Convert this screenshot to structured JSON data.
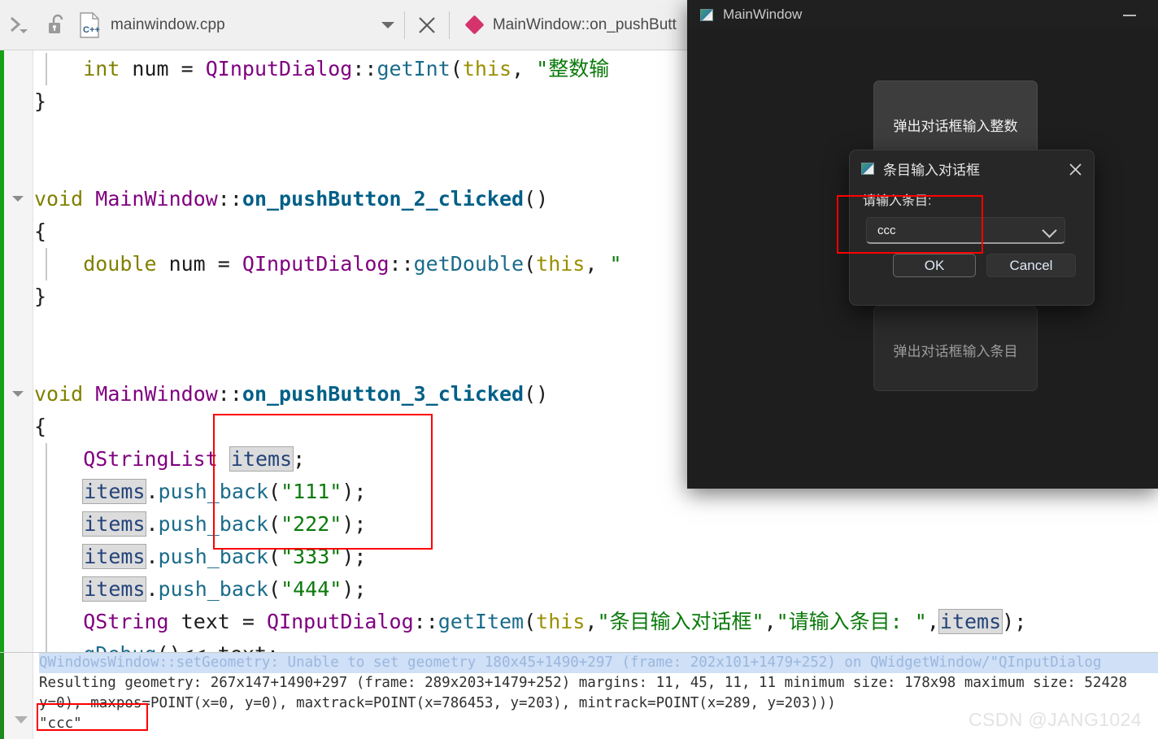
{
  "toolbar": {
    "chevron_icon": "double-chevron-icon",
    "lock_icon": "unlock-icon",
    "file_icon": "cpp-file-icon",
    "file_name": "mainwindow.cpp",
    "dropdown_icon": "chevron-down-icon",
    "close_icon": "close-icon",
    "symbol_icon": "diamond-icon",
    "symbol_name": "MainWindow::on_pushButt"
  },
  "editor": {
    "lines": [
      {
        "indent_guide": true,
        "segments": [
          {
            "cls": "t-kw",
            "text": "    int"
          },
          {
            "cls": "t-plain",
            "text": " "
          },
          {
            "cls": "t-var",
            "text": "num"
          },
          {
            "cls": "t-plain",
            "text": " = "
          },
          {
            "cls": "t-type",
            "text": "QInputDialog"
          },
          {
            "cls": "t-plain",
            "text": "::"
          },
          {
            "cls": "t-mem",
            "text": "getInt"
          },
          {
            "cls": "t-plain",
            "text": "("
          },
          {
            "cls": "t-this",
            "text": "this"
          },
          {
            "cls": "t-plain",
            "text": ", "
          },
          {
            "cls": "t-str",
            "text": "\"整数输"
          }
        ]
      },
      {
        "segments": [
          {
            "cls": "t-plain",
            "text": "}"
          }
        ]
      },
      {
        "segments": []
      },
      {
        "segments": []
      },
      {
        "fold": true,
        "segments": [
          {
            "cls": "t-kw",
            "text": "void"
          },
          {
            "cls": "t-plain",
            "text": " "
          },
          {
            "cls": "t-type",
            "text": "MainWindow"
          },
          {
            "cls": "t-plain",
            "text": "::"
          },
          {
            "cls": "t-fnb",
            "text": "on_pushButton_2_clicked"
          },
          {
            "cls": "t-plain",
            "text": "()"
          }
        ]
      },
      {
        "segments": [
          {
            "cls": "t-plain",
            "text": "{"
          }
        ]
      },
      {
        "indent_guide": true,
        "segments": [
          {
            "cls": "t-kw",
            "text": "    double"
          },
          {
            "cls": "t-plain",
            "text": " "
          },
          {
            "cls": "t-var",
            "text": "num"
          },
          {
            "cls": "t-plain",
            "text": " = "
          },
          {
            "cls": "t-type",
            "text": "QInputDialog"
          },
          {
            "cls": "t-plain",
            "text": "::"
          },
          {
            "cls": "t-mem",
            "text": "getDouble"
          },
          {
            "cls": "t-plain",
            "text": "("
          },
          {
            "cls": "t-this",
            "text": "this"
          },
          {
            "cls": "t-plain",
            "text": ", "
          },
          {
            "cls": "t-str",
            "text": "\""
          }
        ]
      },
      {
        "segments": [
          {
            "cls": "t-plain",
            "text": "}"
          }
        ]
      },
      {
        "segments": []
      },
      {
        "segments": []
      },
      {
        "fold": true,
        "segments": [
          {
            "cls": "t-kw",
            "text": "void"
          },
          {
            "cls": "t-plain",
            "text": " "
          },
          {
            "cls": "t-type",
            "text": "MainWindow"
          },
          {
            "cls": "t-plain",
            "text": "::"
          },
          {
            "cls": "t-fnb",
            "text": "on_pushButton_3_clicked"
          },
          {
            "cls": "t-plain",
            "text": "()"
          }
        ]
      },
      {
        "segments": [
          {
            "cls": "t-plain",
            "text": "{"
          }
        ]
      },
      {
        "indent_guide": true,
        "segments": [
          {
            "cls": "t-type",
            "text": "    QStringList"
          },
          {
            "cls": "t-plain",
            "text": " "
          },
          {
            "cls": "occ",
            "text": "items"
          },
          {
            "cls": "t-plain",
            "text": ";"
          }
        ]
      },
      {
        "indent_guide": true,
        "segments": [
          {
            "cls": "t-plain",
            "text": "    "
          },
          {
            "cls": "occ",
            "text": "items"
          },
          {
            "cls": "t-plain",
            "text": "."
          },
          {
            "cls": "t-mem",
            "text": "push_back"
          },
          {
            "cls": "t-plain",
            "text": "("
          },
          {
            "cls": "t-str",
            "text": "\"111\""
          },
          {
            "cls": "t-plain",
            "text": ");"
          }
        ]
      },
      {
        "indent_guide": true,
        "segments": [
          {
            "cls": "t-plain",
            "text": "    "
          },
          {
            "cls": "occ",
            "text": "items"
          },
          {
            "cls": "t-plain",
            "text": "."
          },
          {
            "cls": "t-mem",
            "text": "push_back"
          },
          {
            "cls": "t-plain",
            "text": "("
          },
          {
            "cls": "t-str",
            "text": "\"222\""
          },
          {
            "cls": "t-plain",
            "text": ");"
          }
        ]
      },
      {
        "indent_guide": true,
        "segments": [
          {
            "cls": "t-plain",
            "text": "    "
          },
          {
            "cls": "occ",
            "text": "items"
          },
          {
            "cls": "t-plain",
            "text": "."
          },
          {
            "cls": "t-mem",
            "text": "push_back"
          },
          {
            "cls": "t-plain",
            "text": "("
          },
          {
            "cls": "t-str",
            "text": "\"333\""
          },
          {
            "cls": "t-plain",
            "text": ");"
          }
        ]
      },
      {
        "indent_guide": true,
        "segments": [
          {
            "cls": "t-plain",
            "text": "    "
          },
          {
            "cls": "occ",
            "text": "items"
          },
          {
            "cls": "t-plain",
            "text": "."
          },
          {
            "cls": "t-mem",
            "text": "push_back"
          },
          {
            "cls": "t-plain",
            "text": "("
          },
          {
            "cls": "t-str",
            "text": "\"444\""
          },
          {
            "cls": "t-plain",
            "text": ");"
          }
        ]
      },
      {
        "indent_guide": true,
        "segments": [
          {
            "cls": "t-type",
            "text": "    QString"
          },
          {
            "cls": "t-plain",
            "text": " "
          },
          {
            "cls": "t-var",
            "text": "text"
          },
          {
            "cls": "t-plain",
            "text": " = "
          },
          {
            "cls": "t-type",
            "text": "QInputDialog"
          },
          {
            "cls": "t-plain",
            "text": "::"
          },
          {
            "cls": "t-mem",
            "text": "getItem"
          },
          {
            "cls": "t-plain",
            "text": "("
          },
          {
            "cls": "t-this",
            "text": "this"
          },
          {
            "cls": "t-plain",
            "text": ","
          },
          {
            "cls": "t-str",
            "text": "\"条目输入对话框\""
          },
          {
            "cls": "t-plain",
            "text": ","
          },
          {
            "cls": "t-str",
            "text": "\"请输入条目: \""
          },
          {
            "cls": "t-plain",
            "text": ","
          },
          {
            "cls": "occ",
            "text": "items"
          },
          {
            "cls": "t-plain",
            "text": ");"
          }
        ]
      },
      {
        "indent_guide": true,
        "segments": [
          {
            "cls": "t-plain",
            "text": "    "
          },
          {
            "cls": "t-mem",
            "text": "qDebug"
          },
          {
            "cls": "t-plain",
            "text": "()<< "
          },
          {
            "cls": "t-var",
            "text": "text"
          },
          {
            "cls": "t-plain",
            "text": ";"
          }
        ]
      },
      {
        "segments": [
          {
            "cls": "t-plain",
            "text": "}"
          }
        ]
      }
    ]
  },
  "console": {
    "lines": [
      {
        "selected": true,
        "text": "QWindowsWindow::setGeometry: Unable to set geometry 180x45+1490+297 (frame: 202x101+1479+252) on QWidgetWindow/\"QInputDialog"
      },
      {
        "selected": false,
        "text": "Resulting geometry: 267x147+1490+297 (frame: 289x203+1479+252) margins: 11, 45, 11, 11 minimum size: 178x98 maximum size: 52428"
      },
      {
        "selected": false,
        "text": "y=0), maxpos=POINT(x=0, y=0), maxtrack=POINT(x=786453, y=203), mintrack=POINT(x=289, y=203)))"
      },
      {
        "selected": false,
        "text": "\"ccc\""
      }
    ],
    "scroll_down_icon": "chevron-down-icon",
    "watermark": "CSDN @JANG1024"
  },
  "qt_window": {
    "app_icon": "qt-app-icon",
    "title": "MainWindow",
    "minimize_icon": "minimize-icon",
    "button_int": "弹出对话框输入整数",
    "button_item": "弹出对话框输入条目"
  },
  "qt_dialog": {
    "app_icon": "qt-app-icon",
    "title": "条目输入对话框",
    "close_icon": "close-icon",
    "label": "请输入条目:",
    "combo_value": "ccc",
    "combo_chevron_icon": "chevron-down-icon",
    "ok_label": "OK",
    "cancel_label": "Cancel"
  },
  "annotations": {
    "accent_red": "#ff0000",
    "modified_marker_green": "#16a016",
    "symbol_accent": "#d5336b"
  }
}
